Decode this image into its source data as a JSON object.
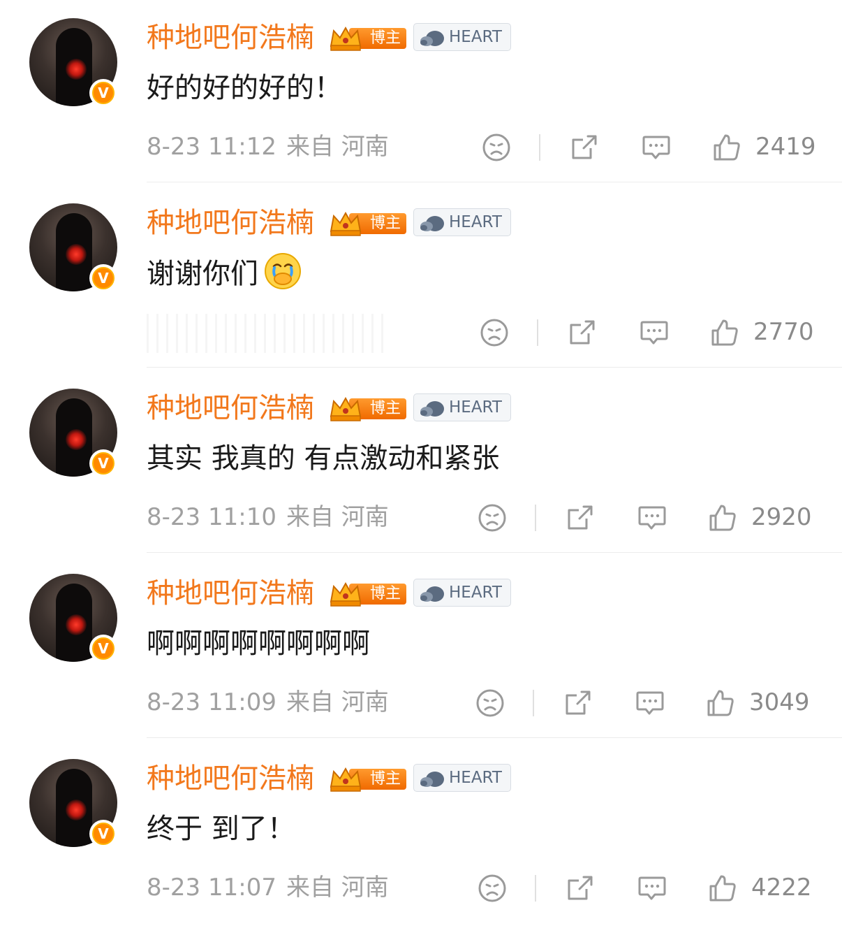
{
  "comments": [
    {
      "name": "种地吧何浩楠",
      "badge": "博主",
      "tag": "HEART",
      "text": "好的好的好的！",
      "time": "8-23 11:12",
      "from": "来自 河南",
      "likes": "2419",
      "emoji": false,
      "meta_visible": true
    },
    {
      "name": "种地吧何浩楠",
      "badge": "博主",
      "tag": "HEART",
      "text": "谢谢你们",
      "time": "",
      "from": "",
      "likes": "2770",
      "emoji": true,
      "meta_visible": false
    },
    {
      "name": "种地吧何浩楠",
      "badge": "博主",
      "tag": "HEART",
      "text": "其实 我真的 有点激动和紧张",
      "time": "8-23 11:10",
      "from": "来自 河南",
      "likes": "2920",
      "emoji": false,
      "meta_visible": true
    },
    {
      "name": "种地吧何浩楠",
      "badge": "博主",
      "tag": "HEART",
      "text": "啊啊啊啊啊啊啊啊",
      "time": "8-23 11:09",
      "from": "来自 河南",
      "likes": "3049",
      "emoji": false,
      "meta_visible": true
    },
    {
      "name": "种地吧何浩楠",
      "badge": "博主",
      "tag": "HEART",
      "text": "终于 到了！",
      "time": "8-23 11:07",
      "from": "来自 河南",
      "likes": "4222",
      "emoji": false,
      "meta_visible": true
    }
  ],
  "icons": {
    "dislike": "sad-face-icon",
    "share": "share-icon",
    "reply": "comment-bubble-icon",
    "like": "thumbs-up-icon",
    "verified": "verified-v-icon",
    "emoji": "crying-covering-mouth-emoji"
  },
  "verified_mark": "V",
  "colors": {
    "name": "#f2781c",
    "text": "#1a1a1a",
    "meta": "#a0a0a0",
    "badge": "#f06a00",
    "verified": "#ff8a00"
  }
}
